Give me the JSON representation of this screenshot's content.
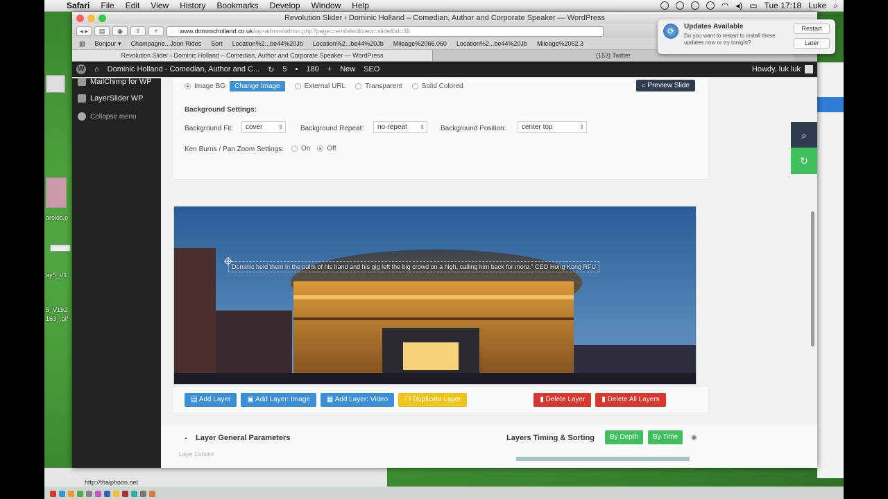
{
  "menubar": {
    "app": "Safari",
    "items": [
      "File",
      "Edit",
      "View",
      "History",
      "Bookmarks",
      "Develop",
      "Window",
      "Help"
    ],
    "clock": "Tue 17:18",
    "user": "Luke"
  },
  "browser": {
    "window_title": "Revolution Slider ‹ Dominic Holland – Comedian, Author and Corporate Speaker — WordPress",
    "url_host": "www.dominicholland.co.uk",
    "url_path": "/wp-admin/admin.php?page=revslider&view=slide&id=38",
    "bookmarks": [
      "Bonjour ▾",
      "Champagne...Joon Rides",
      "Sort",
      "Location%2...be44%20Jb",
      "Location%2...be44%20Jb",
      "Mileage%2066.060",
      "Location%2...be44%20Jb",
      "Mileage%2062.3"
    ],
    "tabs": [
      "Revolution Slider ‹ Dominic Holland – Comedian, Author and Corporate Speaker — WordPress",
      "(153) Twitter"
    ]
  },
  "wpbar": {
    "site": "Dominic Holland - Comedian, Author and C...",
    "updates": "5",
    "comments": "180",
    "new": "New",
    "seo": "SEO",
    "howdy": "Howdy, luk luk"
  },
  "sidemenu": {
    "items": [
      "MailChimp for WP",
      "LayerSlider WP"
    ],
    "collapse": "Collapse menu"
  },
  "background": {
    "source_options": [
      "Image BG",
      "External URL",
      "Transparent",
      "Solid Colored"
    ],
    "change_image": "Change Image",
    "preview": "Preview Slide",
    "settings_title": "Background Settings:",
    "fit_label": "Background Fit:",
    "fit_value": "cover",
    "repeat_label": "Background Repeat:",
    "repeat_value": "no-repeat",
    "position_label": "Background Position:",
    "position_value": "center top",
    "kenburns_label": "Ken Burns / Pan Zoom Settings:",
    "kb_on": "On",
    "kb_off": "Off"
  },
  "slide": {
    "caption": "Dominic held them in the palm of his hand and his gig left the big crowd on a high, calling him back for more.\" CEO Hong Kong RFU"
  },
  "layer_buttons": {
    "add_layer": "Add Layer",
    "add_image": "Add Layer: Image",
    "add_video": "Add Layer: Video",
    "duplicate": "Duplicate Layer",
    "delete": "Delete Layer",
    "delete_all": "Delete All Layers"
  },
  "params": {
    "title": "Layer General Parameters",
    "collapse_symbol": "-",
    "sub": "Layer Content",
    "timing_title": "Layers Timing & Sorting",
    "by_depth": "By Depth",
    "by_time": "By Time"
  },
  "notification": {
    "title": "Updates Available",
    "body": "Do you want to restart to install these updates now or try tonight?",
    "restart": "Restart",
    "later": "Later"
  },
  "desktop": {
    "labels": [
      "aroids.p",
      "ay5_V1",
      "5_V192",
      "163_.gif",
      "http://thaiphoon.net"
    ]
  },
  "colors": {
    "accent_blue": "#3a8fd8",
    "duplicate_yellow": "#f0c419",
    "delete_red": "#d9372e",
    "sort_green": "#3ec05c",
    "wp_dark": "#222222"
  }
}
